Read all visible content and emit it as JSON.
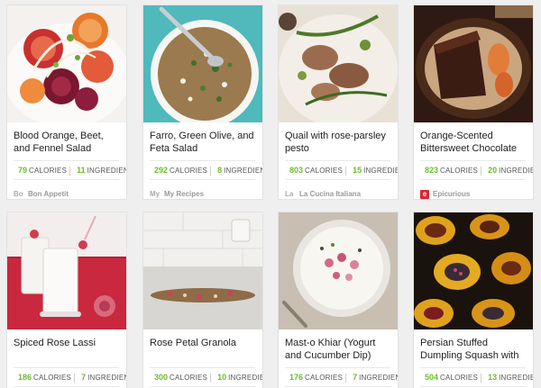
{
  "stats_labels": {
    "calories": "CALORIES",
    "ingredients": "INGREDIENTS"
  },
  "recipes": [
    {
      "title": "Blood Orange, Beet, and Fennel Salad",
      "calories": "79",
      "ingredients": "11",
      "source_logo": "Bo",
      "source": "Bon Appetit",
      "photo": "blood-orange-beet-salad"
    },
    {
      "title": "Farro, Green Olive, and Feta Salad",
      "calories": "292",
      "ingredients": "8",
      "source_logo": "My",
      "source": "My Recipes",
      "photo": "farro-salad-bowl"
    },
    {
      "title": "Quail with rose-parsley pesto",
      "calories": "803",
      "ingredients": "15",
      "source_logo": "La",
      "source": "La Cucina Italiana",
      "photo": "quail-with-pesto"
    },
    {
      "title": "Orange-Scented Bittersweet Chocolate Cake with",
      "calories": "823",
      "ingredients": "20",
      "source_logo": "e",
      "source": "Epicurious",
      "photo": "chocolate-cake-slice"
    },
    {
      "title": "Spiced Rose Lassi",
      "calories": "186",
      "ingredients": "7",
      "source_logo": "",
      "source": "",
      "photo": "rose-lassi-glasses"
    },
    {
      "title": "Rose Petal Granola",
      "calories": "300",
      "ingredients": "10",
      "source_logo": "",
      "source": "",
      "photo": "rose-petal-granola"
    },
    {
      "title": "Mast-o Khiar (Yogurt and Cucumber Dip)",
      "calories": "176",
      "ingredients": "7",
      "source_logo": "",
      "source": "",
      "photo": "yogurt-dip-bowl"
    },
    {
      "title": "Persian Stuffed Dumpling Squash with Rose Petals",
      "calories": "504",
      "ingredients": "13",
      "source_logo": "",
      "source": "",
      "photo": "stuffed-squash"
    }
  ],
  "colors": {
    "accent_green": "#6dbb2d",
    "epicurious_red": "#d9272e"
  }
}
